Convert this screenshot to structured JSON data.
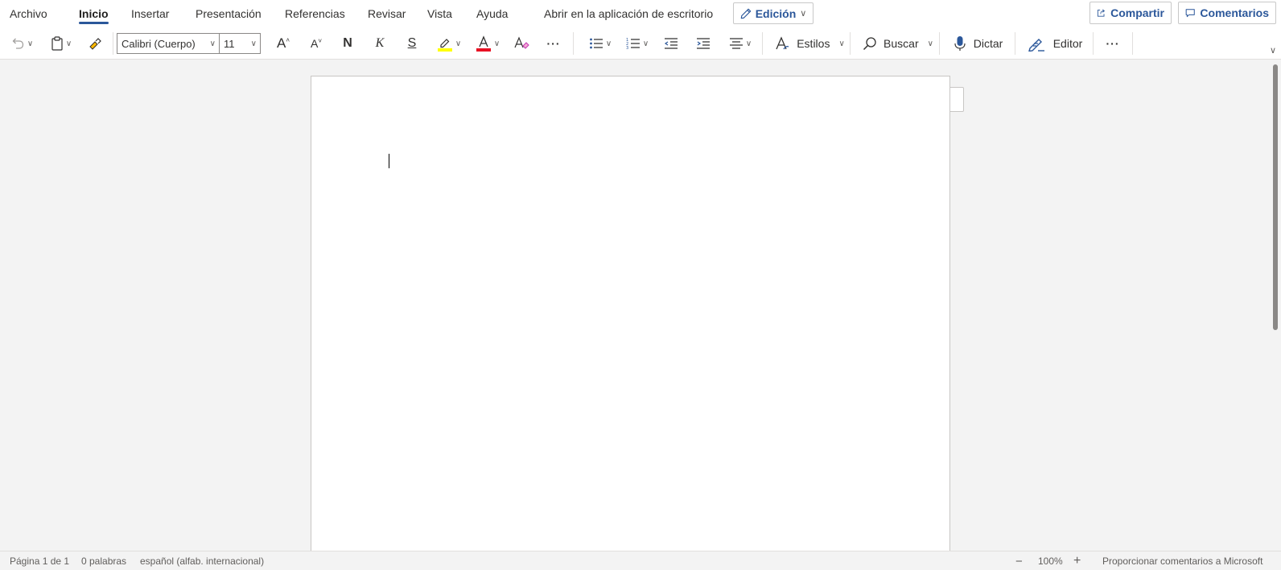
{
  "menu": {
    "tabs": [
      "Archivo",
      "Inicio",
      "Insertar",
      "Presentación",
      "Referencias",
      "Revisar",
      "Vista",
      "Ayuda"
    ],
    "active_tab": "Inicio",
    "open_desktop": "Abrir en la aplicación de escritorio",
    "edit_mode": "Edición",
    "share": "Compartir",
    "comments": "Comentarios"
  },
  "ribbon": {
    "font_name": "Calibri (Cuerpo)",
    "font_size": "11",
    "bold": "N",
    "italic": "K",
    "strike": "S",
    "styles": "Estilos",
    "find": "Buscar",
    "dictate": "Dictar",
    "editor": "Editor",
    "more": "···"
  },
  "colors": {
    "accent": "#2b579a",
    "highlight": "#ffff00",
    "font_color": "#e81123"
  },
  "status": {
    "page": "Página 1 de 1",
    "words": "0 palabras",
    "language": "español (alfab. internacional)",
    "zoom": "100%",
    "feedback": "Proporcionar comentarios a Microsoft"
  }
}
